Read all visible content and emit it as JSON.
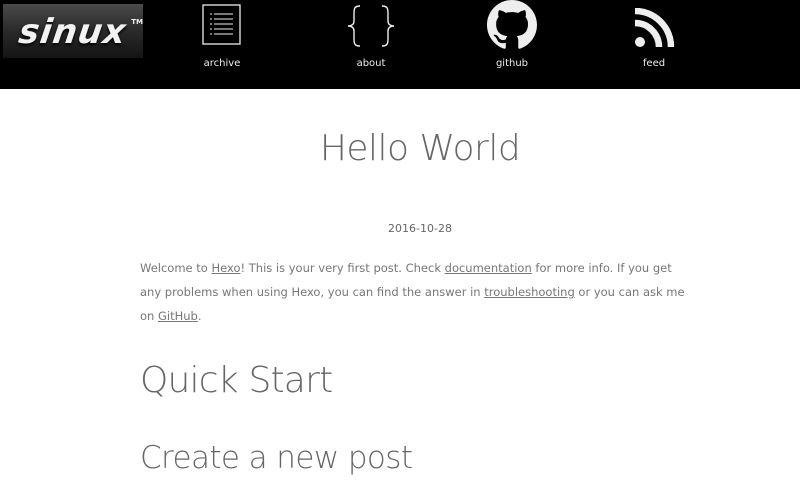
{
  "header": {
    "logo": {
      "text": "sinux",
      "trademark": "TM"
    },
    "nav": [
      {
        "label": "archive",
        "icon": "list-icon"
      },
      {
        "label": "about",
        "icon": "curly-braces-icon"
      },
      {
        "label": "github",
        "icon": "github-icon"
      },
      {
        "label": "feed",
        "icon": "rss-icon"
      }
    ]
  },
  "post": {
    "title": "Hello World",
    "date": "2016-10-28",
    "body": {
      "t1": "Welcome to ",
      "link_hexo": "Hexo",
      "t2": "! This is your very first post. Check ",
      "link_docs": "documentation",
      "t3": " for more info. If you get any problems when using Hexo, you can find the answer in ",
      "link_trouble": "troubleshooting",
      "t4": " or you can ask me on ",
      "link_github": "GitHub",
      "t5": "."
    },
    "heading_quick_start": "Quick Start",
    "heading_create_post": "Create a new post"
  },
  "colors": {
    "header_bg": "#000000",
    "page_bg": "#ffffff",
    "text": "#777777",
    "heading": "#666666"
  }
}
